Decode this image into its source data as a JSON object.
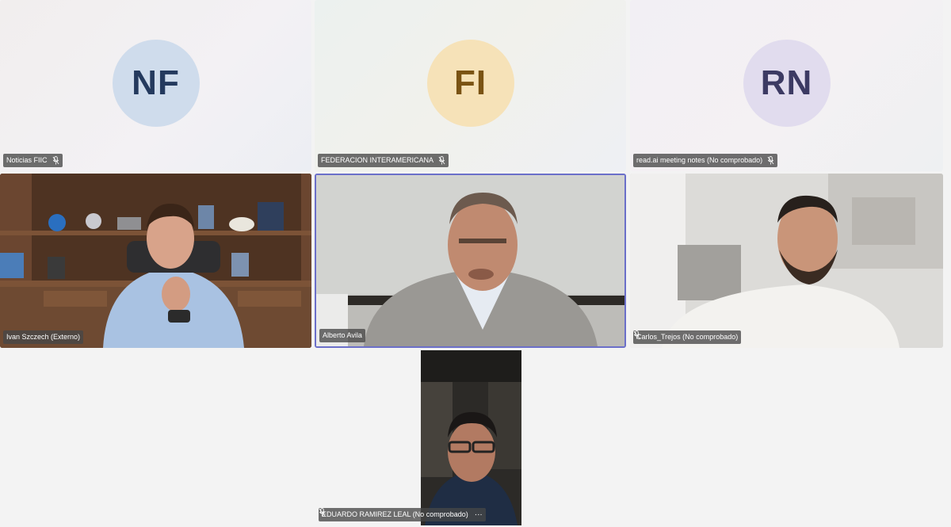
{
  "participants": [
    {
      "initials": "NF",
      "name": "Noticias FIIC",
      "avatar_bg": "#cfdcec",
      "avatar_fg": "#243a5e",
      "icon": "mic-off-icon"
    },
    {
      "initials": "FI",
      "name": "FEDERACION INTERAMERICANA",
      "avatar_bg": "#f6e2b8",
      "avatar_fg": "#7a5313",
      "icon": "mic-off-icon"
    },
    {
      "initials": "RN",
      "name": "read.ai meeting notes (No comprobado)",
      "avatar_bg": "#e1dcee",
      "avatar_fg": "#3c3a63",
      "icon": "mic-off-icon"
    },
    {
      "name": "Ivan Szczech (Externo)"
    },
    {
      "name": "Alberto Avila",
      "active_speaker": true
    },
    {
      "name": "Carlos_Trejos (No comprobado)",
      "icon": "mic-off-icon"
    },
    {
      "name": "EDUARDO RAMIREZ LEAL (No comprobado)",
      "icon": "mic-off-icon",
      "more": "···"
    }
  ],
  "colors": {
    "active_border": "#6b6fc9",
    "nameplate_bg": "#464646"
  }
}
